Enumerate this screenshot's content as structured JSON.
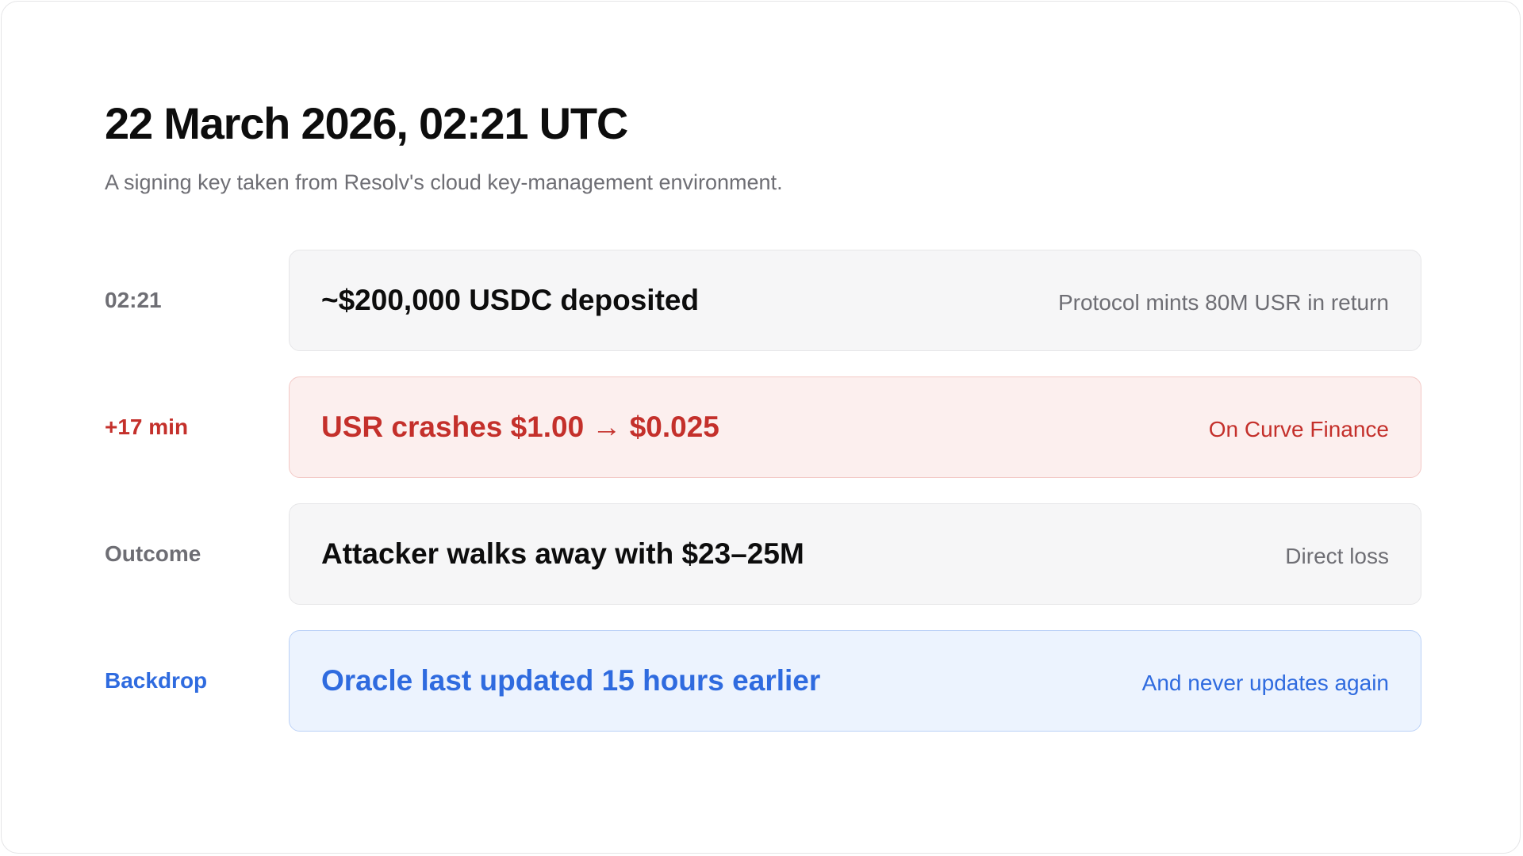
{
  "header": {
    "title": "22 March 2026, 02:21 UTC",
    "subtitle": "A signing key taken from Resolv's cloud key-management environment."
  },
  "timeline": [
    {
      "label": "02:21",
      "main": "~$200,000 USDC deposited",
      "note": "Protocol mints 80M USR in return",
      "tone": "neutral"
    },
    {
      "label": "+17 min",
      "main": "USR crashes $1.00 → $0.025",
      "note": "On Curve Finance",
      "tone": "red"
    },
    {
      "label": "Outcome",
      "main": "Attacker walks away with $23–25M",
      "note": "Direct loss",
      "tone": "neutral"
    },
    {
      "label": "Backdrop",
      "main": "Oracle last updated 15 hours earlier",
      "note": "And never updates again",
      "tone": "blue"
    }
  ],
  "colors": {
    "red": "#c4302b",
    "blue": "#2f6bdf",
    "gray_text": "#6e6e74",
    "neutral_bg": "#f6f6f7",
    "red_bg": "#fcefee",
    "blue_bg": "#ecf3fe"
  }
}
